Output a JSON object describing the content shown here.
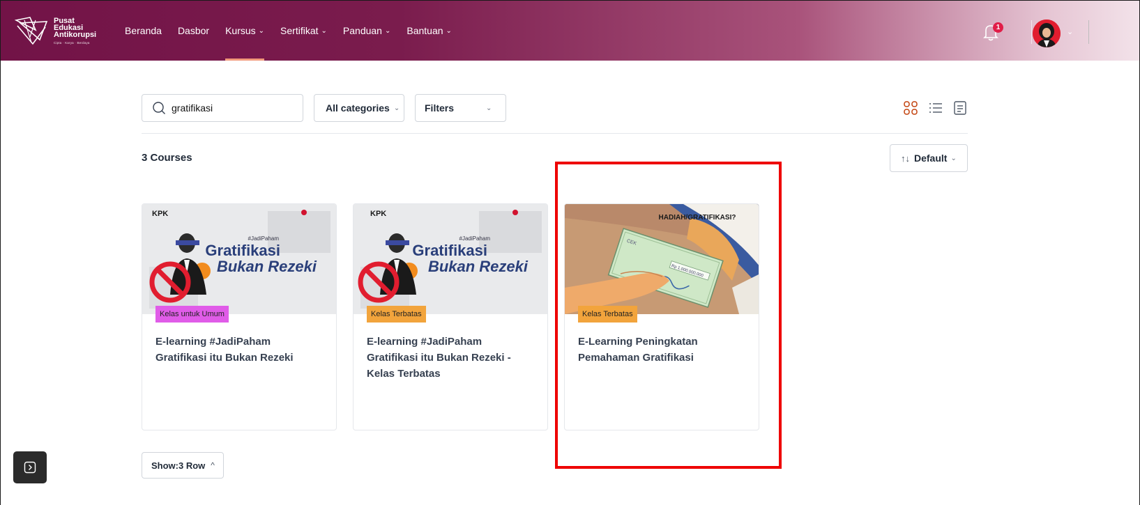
{
  "header": {
    "logo": {
      "line1": "Pusat",
      "line2": "Edukasi",
      "line3": "Antikorupsi",
      "tagline": "Cipta · Karya · Berdaya"
    },
    "nav": [
      {
        "label": "Beranda",
        "dropdown": false
      },
      {
        "label": "Dasbor",
        "dropdown": false
      },
      {
        "label": "Kursus",
        "dropdown": true,
        "active": true
      },
      {
        "label": "Sertifikat",
        "dropdown": true
      },
      {
        "label": "Panduan",
        "dropdown": true
      },
      {
        "label": "Bantuan",
        "dropdown": true
      }
    ],
    "notification_count": "1",
    "chevron": "⌄"
  },
  "toolbar": {
    "search_value": "gratifikasi",
    "category_label": "All categories",
    "filters_label": "Filters",
    "view_modes": [
      "grid-view-icon",
      "list-view-icon",
      "summary-view-icon"
    ]
  },
  "results": {
    "count_label": "3 Courses",
    "sort_label": "Default",
    "sort_arrows": "↑↓"
  },
  "courses": [
    {
      "tag": "Kelas untuk Umum",
      "title": "E-learning #JadiPaham Gratifikasi itu Bukan Rezeki",
      "thumb": {
        "brand": "KPK",
        "hashtag": "#JadiPaham",
        "line1": "Gratifikasi",
        "line2": "Bukan Rezeki"
      }
    },
    {
      "tag": "Kelas Terbatas",
      "title": "E-learning #JadiPaham Gratifikasi itu Bukan Rezeki - Kelas Terbatas",
      "thumb": {
        "brand": "KPK",
        "hashtag": "#JadiPaham",
        "line1": "Gratifikasi",
        "line2": "Bukan Rezeki"
      }
    },
    {
      "tag": "Kelas Terbatas",
      "title": "E-Learning Peningkatan Pemahaman Gratifikasi",
      "thumb": {
        "heading": "HADIAH/GRATIFIKASI?",
        "cek": "CEK",
        "amount": "Rp 1.000.000.000"
      }
    }
  ],
  "pagination": {
    "show_label": "Show:3 Row",
    "chevron": "^"
  },
  "colors": {
    "brand": "#721347",
    "accent_underline": "#f29a7c",
    "tag_umum": "#e05ce8",
    "tag_terbatas": "#f2a43c",
    "highlight": "#ee0000"
  }
}
